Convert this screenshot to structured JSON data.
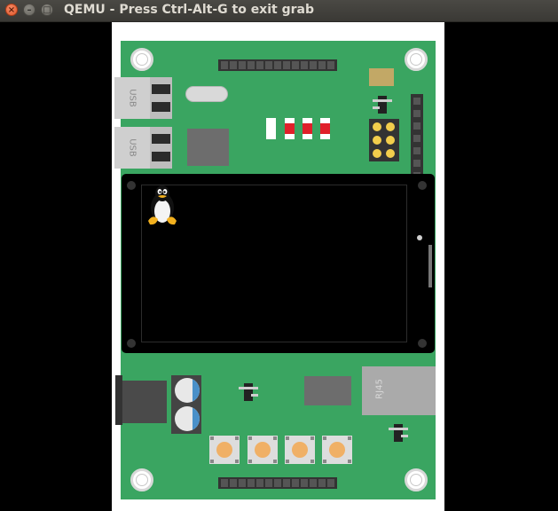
{
  "window": {
    "title": "QEMU - Press Ctrl-Alt-G to exit grab",
    "close_glyph": "×",
    "minimize_glyph": "–",
    "maximize_glyph": "□"
  },
  "board": {
    "usb_ports": [
      {
        "label": "USB"
      },
      {
        "label": "USB"
      }
    ],
    "ethernet": {
      "label": "RJ45"
    },
    "leds": [
      {
        "state": "off",
        "color": "#ffffff"
      },
      {
        "state": "on",
        "color": "#e0202a"
      },
      {
        "state": "on",
        "color": "#e0202a"
      },
      {
        "state": "on",
        "color": "#e0202a"
      }
    ],
    "push_buttons": 4
  },
  "colors": {
    "pcb": "#3aa561",
    "led_on": "#e0202a",
    "button_knob": "#f0b066",
    "capacitor_stripe": "#4a90c9"
  },
  "icons": {
    "screen_logo": "tux-penguin-icon"
  }
}
